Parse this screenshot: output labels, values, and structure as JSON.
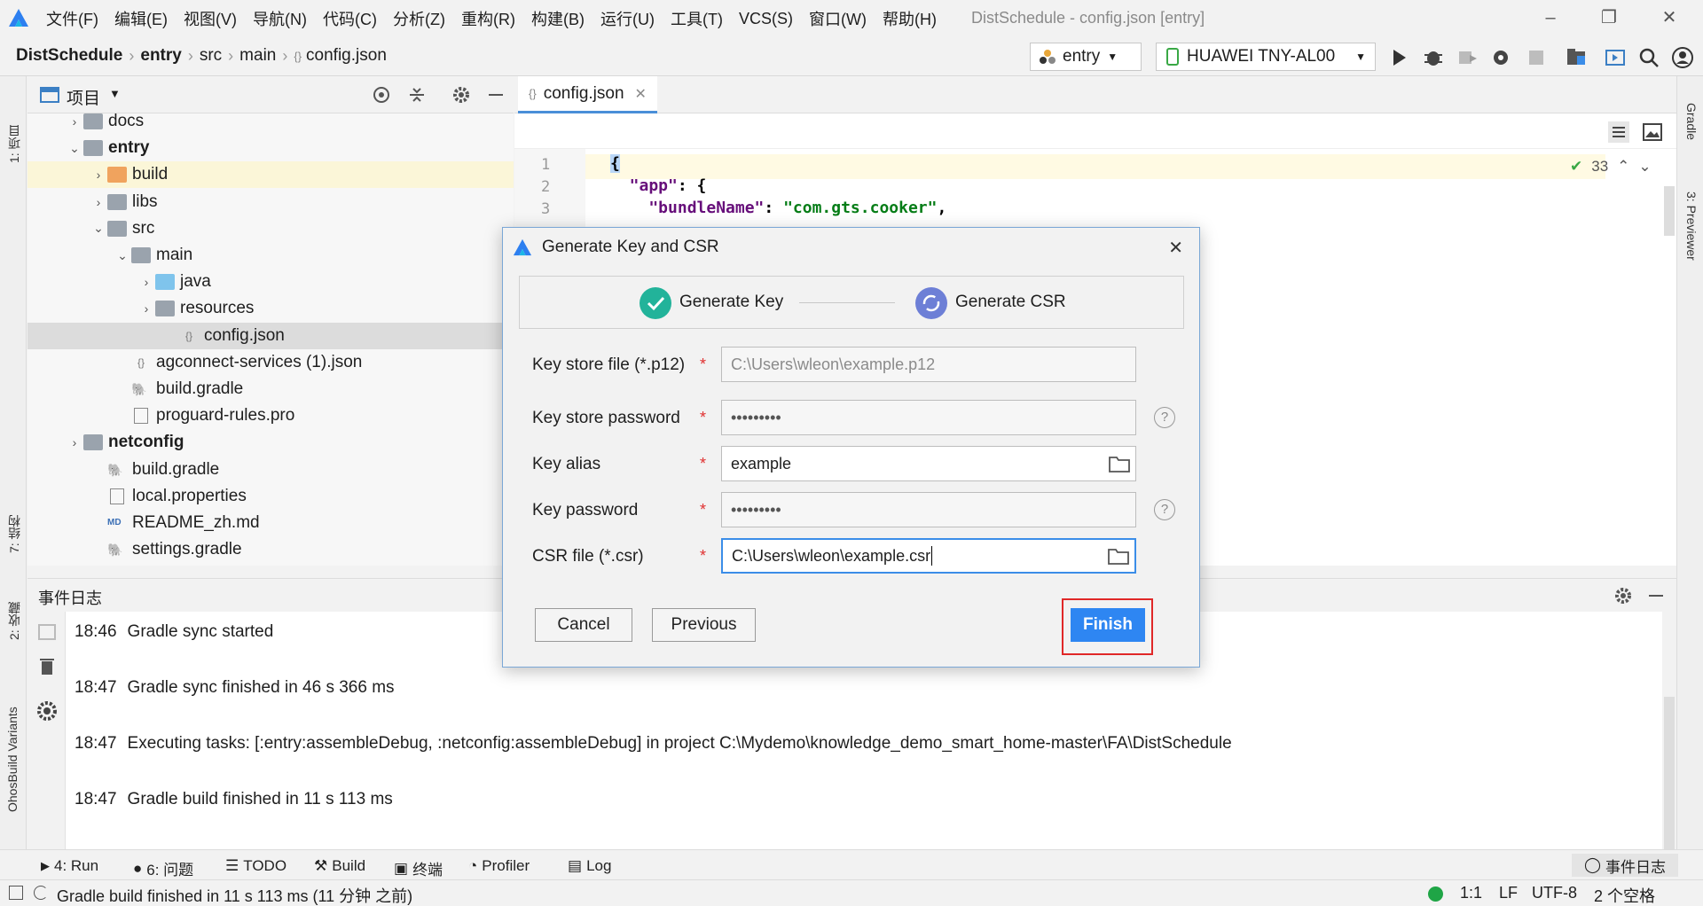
{
  "menubar": {
    "menus": [
      "文件(F)",
      "编辑(E)",
      "视图(V)",
      "导航(N)",
      "代码(C)",
      "分析(Z)",
      "重构(R)",
      "构建(B)",
      "运行(U)",
      "工具(T)",
      "VCS(S)",
      "窗口(W)",
      "帮助(H)"
    ],
    "window_title": "DistSchedule - config.json [entry]"
  },
  "navbar": {
    "breadcrumb": [
      "DistSchedule",
      "entry",
      "src",
      "main",
      "config.json"
    ],
    "module_combo": "entry",
    "device_combo": "HUAWEI TNY-AL00"
  },
  "left_strip": {
    "project": "1: 项目",
    "structure": "7: 结构",
    "favorites": "2: 收藏",
    "variants": "OhosBuild Variants"
  },
  "right_strip": {
    "gradle": "Gradle",
    "previewer": "3: Previewer"
  },
  "project_panel": {
    "title": "项目",
    "tree": [
      {
        "label": "docs",
        "depth": 1,
        "arrow": "›",
        "icon": "folder",
        "bold": false
      },
      {
        "label": "entry",
        "depth": 1,
        "arrow": "⌄",
        "icon": "module-folder",
        "bold": true
      },
      {
        "label": "build",
        "depth": 2,
        "arrow": "›",
        "icon": "folder-orange",
        "bold": false
      },
      {
        "label": "libs",
        "depth": 2,
        "arrow": "›",
        "icon": "folder",
        "bold": false
      },
      {
        "label": "src",
        "depth": 2,
        "arrow": "⌄",
        "icon": "folder",
        "bold": false
      },
      {
        "label": "main",
        "depth": 3,
        "arrow": "⌄",
        "icon": "folder",
        "bold": false
      },
      {
        "label": "java",
        "depth": 4,
        "arrow": "›",
        "icon": "folder-blue",
        "bold": false
      },
      {
        "label": "resources",
        "depth": 4,
        "arrow": "›",
        "icon": "resources-folder",
        "bold": false
      },
      {
        "label": "config.json",
        "depth": 5,
        "arrow": "",
        "icon": "json-file",
        "bold": false
      },
      {
        "label": "agconnect-services (1).json",
        "depth": 3,
        "arrow": "",
        "icon": "json-file",
        "bold": false
      },
      {
        "label": "build.gradle",
        "depth": 3,
        "arrow": "",
        "icon": "gradle-file",
        "bold": false
      },
      {
        "label": "proguard-rules.pro",
        "depth": 3,
        "arrow": "",
        "icon": "text-file",
        "bold": false
      },
      {
        "label": "netconfig",
        "depth": 1,
        "arrow": "›",
        "icon": "module-folder",
        "bold": true
      },
      {
        "label": "build.gradle",
        "depth": 2,
        "arrow": "",
        "icon": "gradle-file",
        "bold": false
      },
      {
        "label": "local.properties",
        "depth": 2,
        "arrow": "",
        "icon": "properties-file",
        "bold": false
      },
      {
        "label": "README_zh.md",
        "depth": 2,
        "arrow": "",
        "icon": "md-file",
        "bold": false
      },
      {
        "label": "settings.gradle",
        "depth": 2,
        "arrow": "",
        "icon": "gradle-file",
        "bold": false
      }
    ]
  },
  "editor": {
    "tab": "config.json",
    "line_numbers": [
      "1",
      "2",
      "3"
    ],
    "lines": [
      {
        "parts": [
          {
            "t": "{",
            "c": "#000000"
          }
        ]
      },
      {
        "parts": [
          {
            "t": "  \"app\"",
            "c": "#660e7a"
          },
          {
            "t": ": {",
            "c": "#000000"
          }
        ]
      },
      {
        "parts": [
          {
            "t": "    \"bundleName\"",
            "c": "#660e7a"
          },
          {
            "t": ": ",
            "c": "#000000"
          },
          {
            "t": "\"com.gts.cooker\"",
            "c": "#067d17"
          },
          {
            "t": ",",
            "c": "#000000"
          }
        ]
      }
    ],
    "inspection_count": "33"
  },
  "event_log": {
    "title": "事件日志",
    "entries": [
      {
        "time": "18:46",
        "text": "Gradle sync started"
      },
      {
        "time": "18:47",
        "text": "Gradle sync finished in 46 s 366 ms"
      },
      {
        "time": "18:47",
        "text": "Executing tasks: [:entry:assembleDebug, :netconfig:assembleDebug] in project C:\\Mydemo\\knowledge_demo_smart_home-master\\FA\\DistSchedule"
      },
      {
        "time": "18:47",
        "text": "Gradle build finished in 11 s 113 ms"
      }
    ]
  },
  "bottom_tools": {
    "run": "4: Run",
    "problems": "6: 问题",
    "todo": "TODO",
    "build": "Build",
    "terminal": "终端",
    "profiler": "Profiler",
    "log": "Log",
    "event_log": "事件日志"
  },
  "status": {
    "message": "Gradle build finished in 11 s 113 ms (11 分钟 之前)",
    "position": "1:1",
    "line_sep": "LF",
    "encoding": "UTF-8",
    "indent": "2 个空格"
  },
  "dialog": {
    "title": "Generate Key and CSR",
    "step1": "Generate Key",
    "step2": "Generate CSR",
    "fields": {
      "keystore_file_label": "Key store file (*.p12)",
      "keystore_file_value": "C:\\Users\\wleon\\example.p12",
      "keystore_password_label": "Key store password",
      "keystore_password_value": "•••••••••",
      "key_alias_label": "Key alias",
      "key_alias_value": "example",
      "key_password_label": "Key password",
      "key_password_value": "•••••••••",
      "csr_file_label": "CSR file (*.csr)",
      "csr_file_value": "C:\\Users\\wleon\\example.csr",
      "required_mark": "*",
      "help_mark": "?"
    },
    "buttons": {
      "cancel": "Cancel",
      "previous": "Previous",
      "finish": "Finish"
    }
  },
  "colors": {
    "accent": "#2e86f2",
    "highlight_box": "#e02828",
    "step_done": "#22b39a",
    "step_active": "#6d7fd6"
  }
}
